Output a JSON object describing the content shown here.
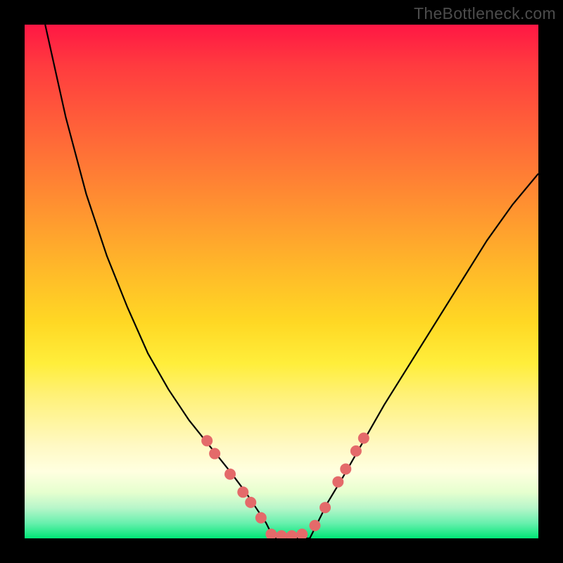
{
  "watermark_text": "TheBottleneck.com",
  "colors": {
    "background": "#000000",
    "gradient_top": "#ff1744",
    "gradient_mid": "#ffee3b",
    "gradient_bottom": "#00e676",
    "curve_stroke": "#000000",
    "dot_fill": "#e46a6a",
    "watermark": "#4c4c4c"
  },
  "chart_data": {
    "type": "line",
    "title": "",
    "xlabel": "",
    "ylabel": "",
    "xlim": [
      0,
      100
    ],
    "ylim": [
      0,
      100
    ],
    "axis_ticks_visible": false,
    "grid": false,
    "legend": false,
    "series": [
      {
        "name": "left-curve",
        "x": [
          4,
          8,
          12,
          16,
          20,
          24,
          28,
          32,
          36,
          40,
          43,
          45,
          47,
          48.5
        ],
        "y": [
          100,
          82,
          67,
          55,
          45,
          36,
          29,
          23,
          18,
          13,
          9,
          6,
          3,
          0
        ]
      },
      {
        "name": "valley-floor",
        "x": [
          48.5,
          50,
          52,
          54,
          55.5
        ],
        "y": [
          0,
          0,
          0,
          0,
          0
        ]
      },
      {
        "name": "right-curve",
        "x": [
          55.5,
          57,
          59,
          62,
          66,
          70,
          75,
          80,
          85,
          90,
          95,
          100
        ],
        "y": [
          0,
          3,
          7,
          12,
          19,
          26,
          34,
          42,
          50,
          58,
          65,
          71
        ]
      }
    ],
    "markers": [
      {
        "name": "left-dot-1",
        "x": 35.5,
        "y": 19.0
      },
      {
        "name": "left-dot-2",
        "x": 37.0,
        "y": 16.5
      },
      {
        "name": "left-dot-3",
        "x": 40.0,
        "y": 12.5
      },
      {
        "name": "left-dot-4",
        "x": 42.5,
        "y": 9.0
      },
      {
        "name": "left-dot-5",
        "x": 44.0,
        "y": 7.0
      },
      {
        "name": "left-dot-6",
        "x": 46.0,
        "y": 4.0
      },
      {
        "name": "floor-dot-1",
        "x": 48.0,
        "y": 0.8
      },
      {
        "name": "floor-dot-2",
        "x": 50.0,
        "y": 0.5
      },
      {
        "name": "floor-dot-3",
        "x": 52.0,
        "y": 0.5
      },
      {
        "name": "floor-dot-4",
        "x": 54.0,
        "y": 0.8
      },
      {
        "name": "right-dot-1",
        "x": 56.5,
        "y": 2.5
      },
      {
        "name": "right-dot-2",
        "x": 58.5,
        "y": 6.0
      },
      {
        "name": "right-dot-3",
        "x": 61.0,
        "y": 11.0
      },
      {
        "name": "right-dot-4",
        "x": 62.5,
        "y": 13.5
      },
      {
        "name": "right-dot-5",
        "x": 64.5,
        "y": 17.0
      },
      {
        "name": "right-dot-6",
        "x": 66.0,
        "y": 19.5
      }
    ]
  }
}
